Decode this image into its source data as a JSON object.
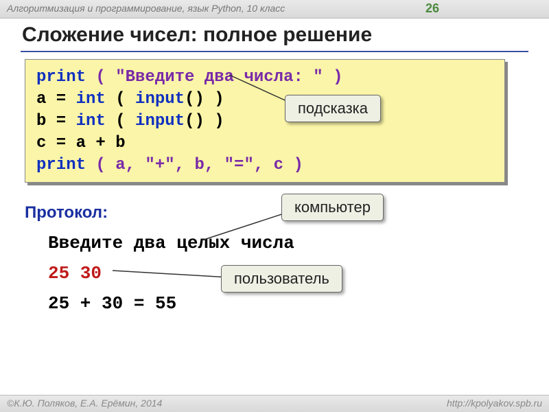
{
  "header": {
    "course": "Алгоритмизация и программирование, язык Python, 10 класс",
    "page": "26"
  },
  "title": "Сложение чисел: полное решение",
  "code": {
    "l1_kw": "print",
    "l1_rest": " ( \"Введите два числа: \" )",
    "l2_a": "a = ",
    "l2_int": "int",
    "l2_mid": " ( ",
    "l2_input": "input",
    "l2_end": "() )",
    "l3_a": "b = ",
    "l3_int": "int",
    "l3_mid": " ( ",
    "l3_input": "input",
    "l3_end": "() )",
    "l4": "c = a + b",
    "l5_kw": "print",
    "l5_rest": " ( a, \"+\", b, \"=\", c )"
  },
  "callouts": {
    "hint": "подсказка",
    "computer": "компьютер",
    "user": "пользователь"
  },
  "protocol": {
    "label": "Протокол:",
    "line1": "Введите два целых числа",
    "line2": "25 30",
    "line3": "25 + 30 = 55"
  },
  "footer": {
    "authors": "К.Ю. Поляков, Е.А. Ерёмин, 2014",
    "url": "http://kpolyakov.spb.ru"
  }
}
